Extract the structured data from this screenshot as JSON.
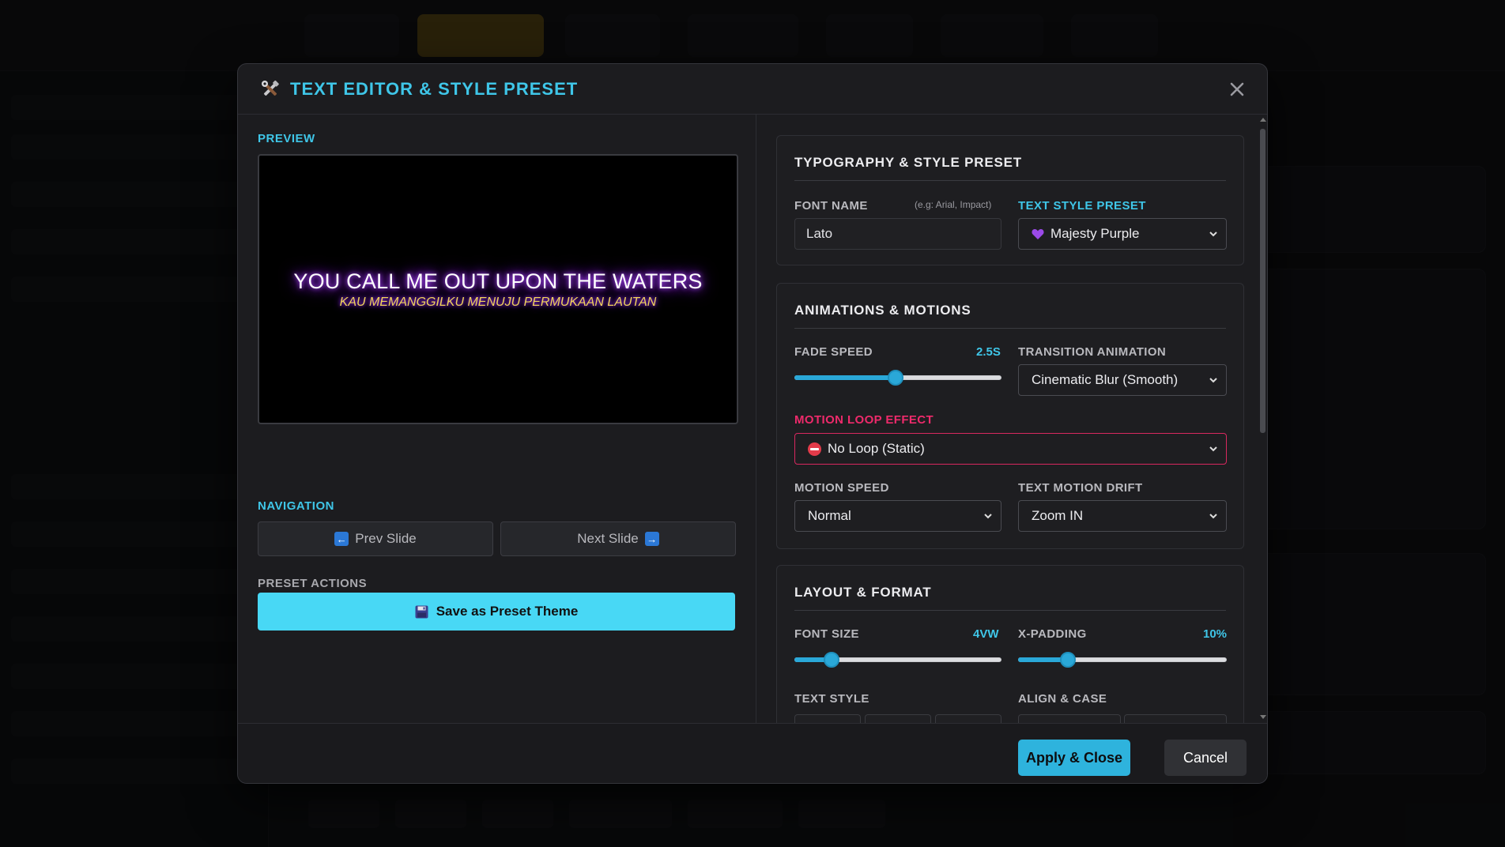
{
  "modal": {
    "title": "TEXT EDITOR & STYLE PRESET",
    "header_icon": "tools-icon",
    "close_icon": "close-icon"
  },
  "preview": {
    "label": "PREVIEW",
    "main_text": "YOU CALL ME OUT UPON THE WATERS",
    "sub_text": "KAU MEMANGGILKU MENUJU PERMUKAAN LAUTAN"
  },
  "navigation": {
    "label": "NAVIGATION",
    "prev_label": "Prev Slide",
    "next_label": "Next Slide",
    "prev_icon": "arrow-left-icon",
    "next_icon": "arrow-right-icon"
  },
  "preset_actions": {
    "label": "PRESET ACTIONS",
    "save_label": "Save as Preset Theme",
    "save_icon": "floppy-disk-icon"
  },
  "typography": {
    "title": "TYPOGRAPHY & STYLE PRESET",
    "font_name_label": "FONT NAME",
    "font_name_hint": "(e.g: Arial, Impact)",
    "font_name_value": "Lato",
    "preset_label": "TEXT STYLE PRESET",
    "preset_value": "Majesty Purple",
    "preset_icon": "purple-heart-icon"
  },
  "animations": {
    "title": "ANIMATIONS & MOTIONS",
    "fade_speed_label": "FADE SPEED",
    "fade_speed_value": "2.5S",
    "fade_speed_fraction": 0.49,
    "transition_label": "TRANSITION ANIMATION",
    "transition_value": "Cinematic Blur (Smooth)",
    "motion_loop_label": "MOTION LOOP EFFECT",
    "motion_loop_value": "No Loop (Static)",
    "motion_loop_icon": "no-entry-icon",
    "motion_speed_label": "MOTION SPEED",
    "motion_speed_value": "Normal",
    "drift_label": "TEXT MOTION DRIFT",
    "drift_value": "Zoom IN"
  },
  "layout": {
    "title": "LAYOUT & FORMAT",
    "font_size_label": "FONT SIZE",
    "font_size_value": "4VW",
    "font_size_fraction": 0.18,
    "x_padding_label": "X-PADDING",
    "x_padding_value": "10%",
    "x_padding_fraction": 0.24,
    "text_style_label": "TEXT STYLE",
    "align_case_label": "ALIGN & CASE"
  },
  "footer": {
    "apply_label": "Apply & Close",
    "cancel_label": "Cancel"
  },
  "colors": {
    "accent": "#3fc6e8",
    "save_button": "#48d8f5",
    "apply_button": "#2eb3dd",
    "warning": "#ee2a6b",
    "glow": "#9b30ff",
    "subtitle": "#f1d45a"
  }
}
